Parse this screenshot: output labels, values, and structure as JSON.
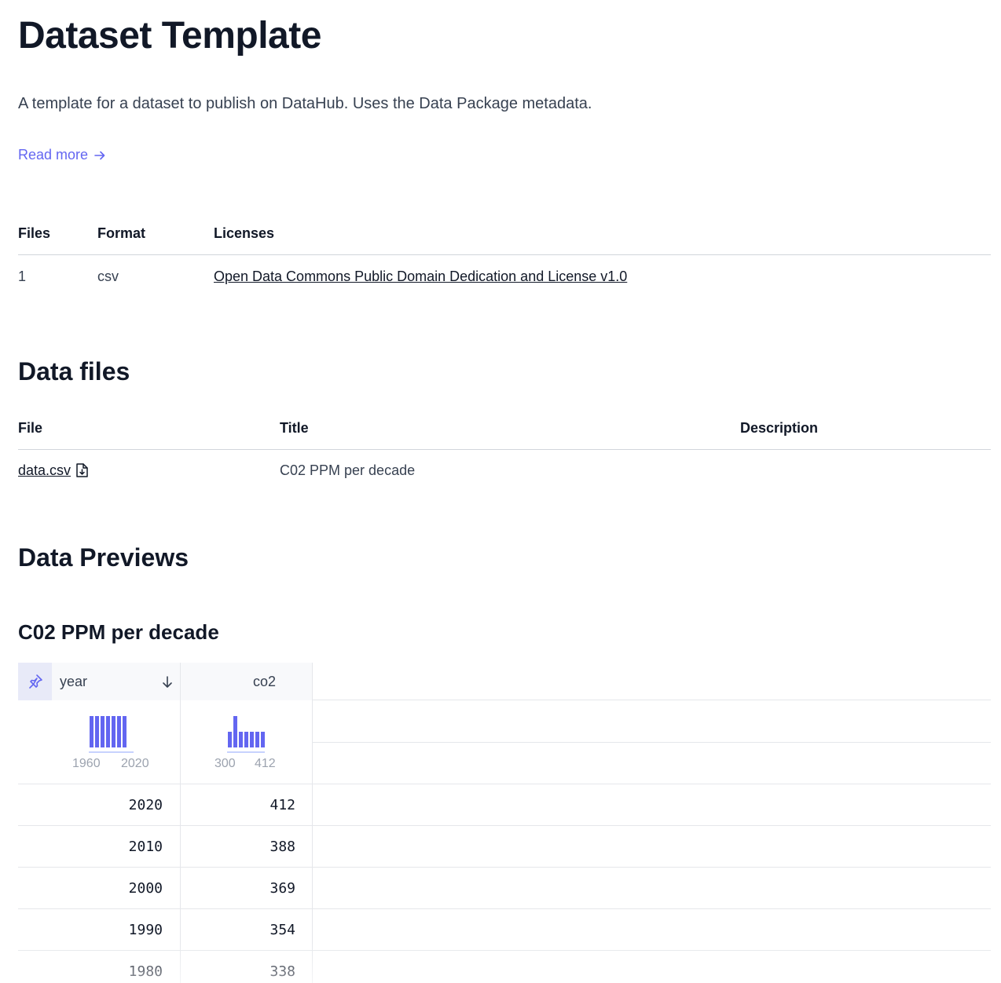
{
  "header": {
    "title": "Dataset Template",
    "description": "A template for a dataset to publish on DataHub. Uses the Data Package metadata.",
    "read_more": "Read more"
  },
  "meta_table": {
    "headers": [
      "Files",
      "Format",
      "Licenses"
    ],
    "row": {
      "files": "1",
      "format": "csv",
      "license": "Open Data Commons Public Domain Dedication and License v1.0"
    }
  },
  "data_files": {
    "heading": "Data files",
    "headers": [
      "File",
      "Title",
      "Description"
    ],
    "rows": [
      {
        "file": "data.csv",
        "title": "C02 PPM per decade",
        "description": ""
      }
    ]
  },
  "previews": {
    "heading": "Data Previews",
    "title": "C02 PPM per decade",
    "columns": [
      {
        "name": "year",
        "hist_min": "1960",
        "hist_max": "2020",
        "hist_bars": [
          1,
          1,
          1,
          1,
          1,
          1,
          1
        ]
      },
      {
        "name": "co2",
        "hist_min": "300",
        "hist_max": "412",
        "hist_bars": [
          0.5,
          1,
          0.5,
          0.5,
          0.5,
          0.5,
          0.5
        ]
      }
    ],
    "rows": [
      {
        "year": "2020",
        "co2": "412"
      },
      {
        "year": "2010",
        "co2": "388"
      },
      {
        "year": "2000",
        "co2": "369"
      },
      {
        "year": "1990",
        "co2": "354"
      },
      {
        "year": "1980",
        "co2": "338"
      }
    ]
  },
  "colors": {
    "accent": "#6366f1",
    "text": "#111827",
    "muted": "#9ca3af",
    "border": "#e5e7eb"
  }
}
